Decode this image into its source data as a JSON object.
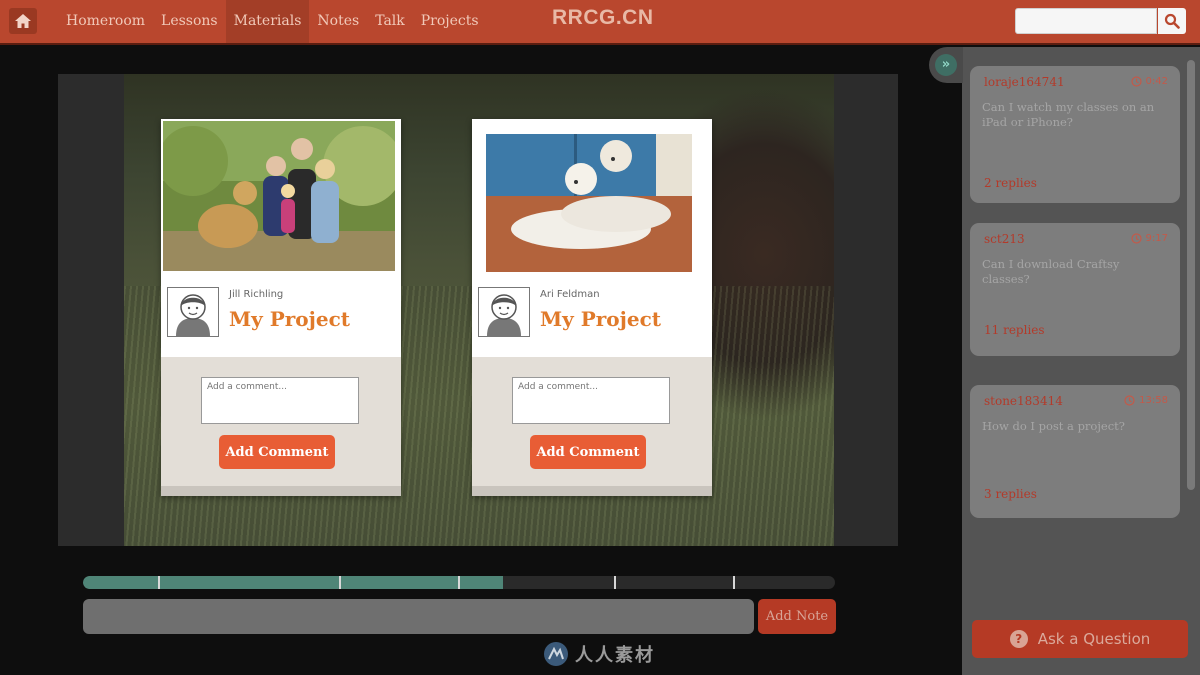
{
  "topbar": {
    "home_icon": "home-icon",
    "nav": [
      "Homeroom",
      "Lessons",
      "Materials",
      "Notes",
      "Talk",
      "Projects"
    ],
    "active_nav": "Materials",
    "brand": "RRCG.CN",
    "search_value": "",
    "search_icon": "magnifier-icon"
  },
  "projects": [
    {
      "author": "Jill Richling",
      "title": "My Project",
      "comment_placeholder": "Add a comment...",
      "button": "Add Comment"
    },
    {
      "author": "Ari Feldman",
      "title": "My Project",
      "comment_placeholder": "Add a comment...",
      "button": "Add Comment"
    }
  ],
  "player": {
    "progress_fraction": 0.558,
    "note_value": "",
    "add_note": "Add Note"
  },
  "watermark": "人人素材",
  "qa": {
    "questions": [
      {
        "user": "loraje164741",
        "time": "0:42",
        "text": "Can I watch my classes on an iPad or iPhone?",
        "replies": "2 replies"
      },
      {
        "user": "sct213",
        "time": "9:17",
        "text": "Can I download Craftsy classes?",
        "replies": "11 replies"
      },
      {
        "user": "stone183414",
        "time": "13:58",
        "text": "How do I post a project?",
        "replies": "3 replies"
      }
    ],
    "ask_button": "Ask a Question"
  },
  "colors": {
    "brand_red": "#b9472e",
    "button_orange": "#e85d35",
    "title_orange": "#e07a2a",
    "progress_teal": "#4f8577"
  }
}
